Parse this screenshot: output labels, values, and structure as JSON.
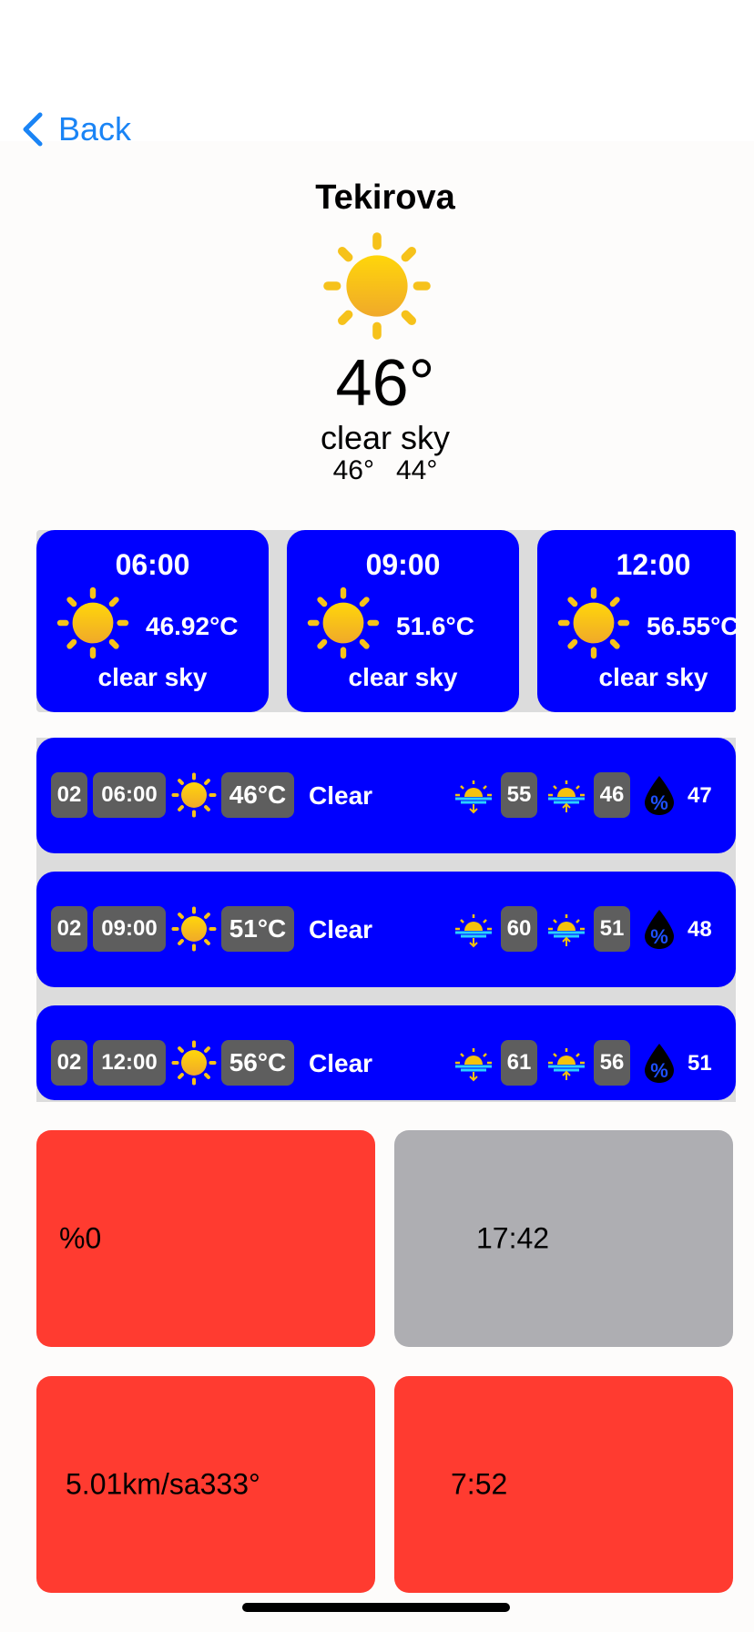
{
  "nav": {
    "back_label": "Back"
  },
  "current": {
    "city": "Tekirova",
    "icon": "sun-icon",
    "temp": "46°",
    "description": "clear sky",
    "high": "46°",
    "low": "44°"
  },
  "hourly": [
    {
      "time": "06:00",
      "temp": "46.92°C",
      "desc": "clear sky"
    },
    {
      "time": "09:00",
      "temp": "51.6°C",
      "desc": "clear sky"
    },
    {
      "time": "12:00",
      "temp": "56.55°C",
      "desc": "clear sky"
    }
  ],
  "forecast_rows": [
    {
      "day": "02",
      "time": "06:00",
      "temp": "46°C",
      "cond": "Clear",
      "max": "55",
      "min": "46",
      "humidity": "47"
    },
    {
      "day": "02",
      "time": "09:00",
      "temp": "51°C",
      "cond": "Clear",
      "max": "60",
      "min": "51",
      "humidity": "48"
    },
    {
      "day": "02",
      "time": "12:00",
      "temp": "56°C",
      "cond": "Clear",
      "max": "61",
      "min": "56",
      "humidity": "51"
    }
  ],
  "tiles": {
    "precipitation": "%0",
    "sunset": "17:42",
    "wind": "5.01km/sa333°",
    "sunrise": "7:52"
  },
  "colors": {
    "accent": "#1a84f5",
    "card": "#0000ff",
    "pill": "#5e5e5e",
    "tile_red": "#ff3b30",
    "tile_gray": "#aeaeb2"
  }
}
